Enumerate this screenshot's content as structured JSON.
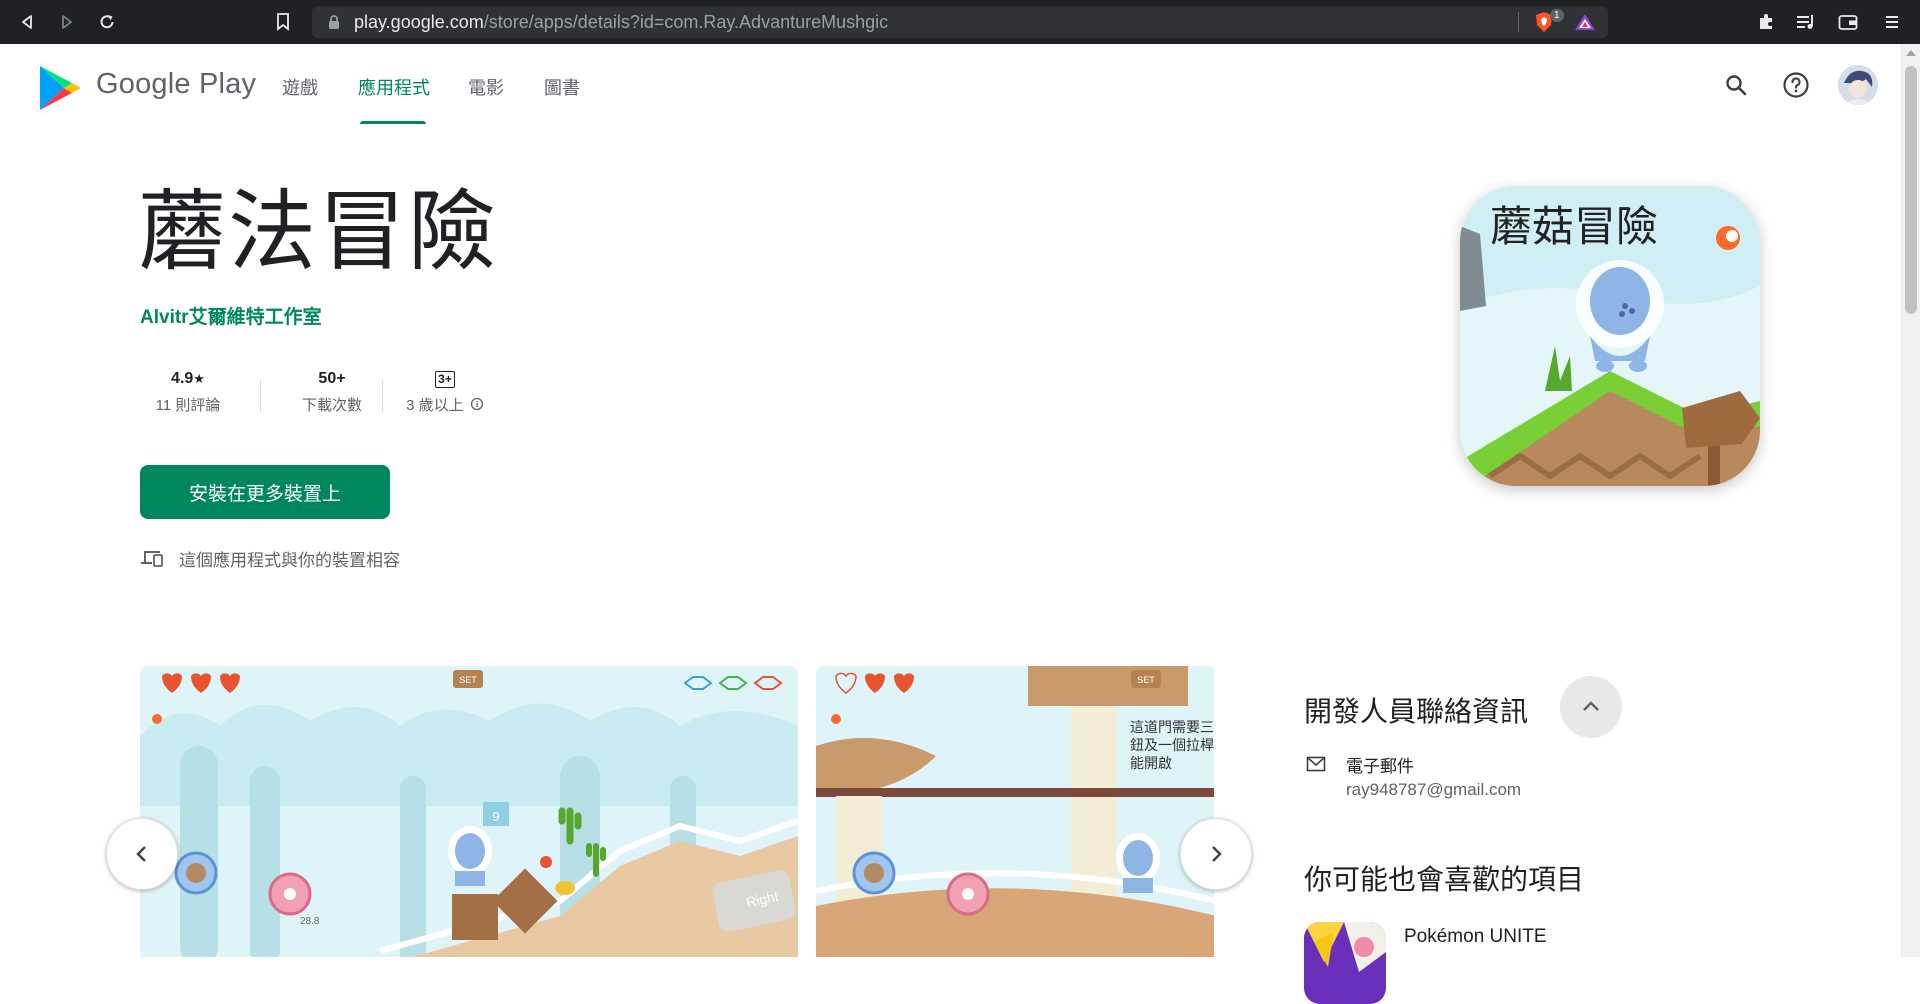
{
  "browser": {
    "url_host": "play.google.com",
    "url_path": "/store/apps/details?id=com.Ray.AdvantureMushgic",
    "shield_count": "1"
  },
  "header": {
    "brand": "Google Play",
    "tabs": [
      {
        "label": "遊戲",
        "active": false
      },
      {
        "label": "應用程式",
        "active": true
      },
      {
        "label": "電影",
        "active": false
      },
      {
        "label": "圖書",
        "active": false
      }
    ],
    "accent_color": "#01875f"
  },
  "app": {
    "title": "蘑法冒險",
    "developer": "Alvitr艾爾維特工作室",
    "stats": {
      "rating_value": "4.9",
      "rating_star": "★",
      "rating_label": "11 則評論",
      "downloads_value": "50+",
      "downloads_label": "下載次數",
      "content_rating_badge": "3+",
      "content_rating_label": "3 歲以上"
    },
    "install_label": "安裝在更多裝置上",
    "compat_text": "這個應用程式與你的裝置相容",
    "icon_title": "蘑菇冒險"
  },
  "screenshots": {
    "shot1": {
      "set_label": "SET",
      "box_number": "9",
      "right_label": "Right",
      "speed": "28.8"
    },
    "shot2": {
      "set_label": "SET",
      "hint": [
        "這道門需要三",
        "鈕及一個拉桿",
        "能開啟"
      ]
    }
  },
  "developer_contact": {
    "title": "開發人員聯絡資訊",
    "email_label": "電子郵件",
    "email_value": "ray948787@gmail.com"
  },
  "recommended": {
    "title": "你可能也會喜歡的項目",
    "items": [
      {
        "name": "Pokémon UNITE"
      }
    ]
  }
}
